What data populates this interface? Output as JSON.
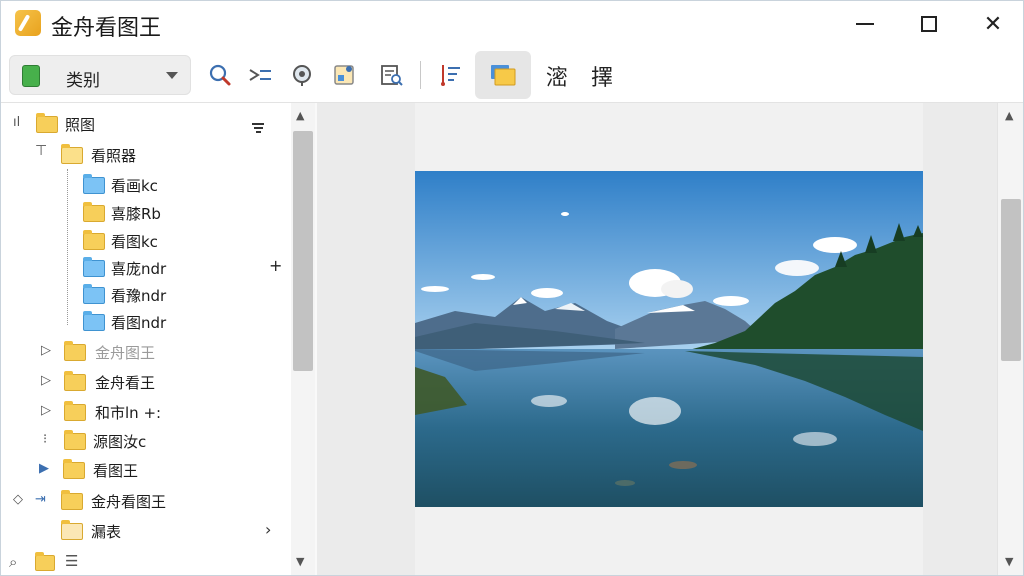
{
  "app": {
    "title": "金舟看图王"
  },
  "window_controls": {
    "minimize": "—",
    "maximize": "☐",
    "close": "✕"
  },
  "toolbar": {
    "category_label": "类别",
    "text_btn_1": "滵",
    "text_btn_2": "擇"
  },
  "tree": {
    "root": "照图",
    "items": [
      {
        "label": "看照器"
      },
      {
        "label": "看画kc"
      },
      {
        "label": "喜膝Rb"
      },
      {
        "label": "看图kc"
      },
      {
        "label": "喜庞ndr"
      },
      {
        "label": "看豫ndr"
      },
      {
        "label": "看图ndr"
      },
      {
        "label": "金舟图王"
      },
      {
        "label": "金舟看王"
      },
      {
        "label": "和市ln +:"
      },
      {
        "label": "源图汝c"
      },
      {
        "label": "看图王"
      },
      {
        "label": "金舟看图王"
      },
      {
        "label": "漏表"
      }
    ]
  },
  "colors": {
    "folder": "#f7cf5a",
    "folder_blue": "#7cc3f5",
    "accent": "#2f7d34"
  }
}
